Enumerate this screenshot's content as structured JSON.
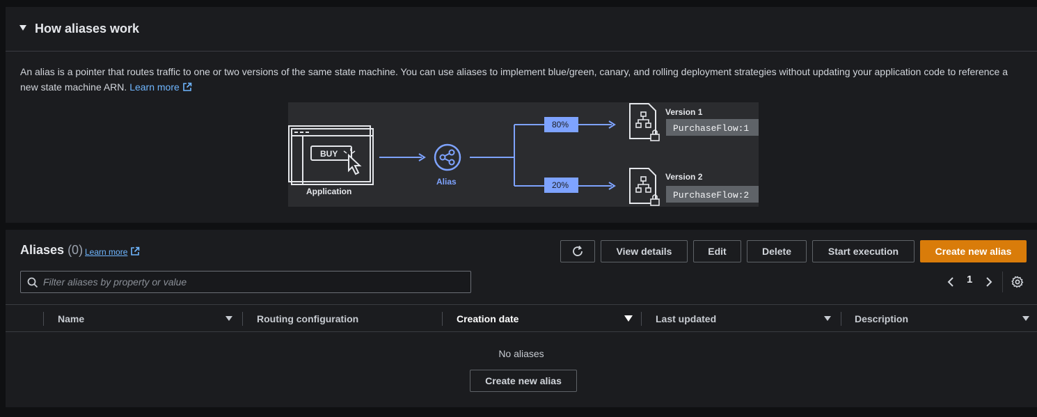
{
  "how_it_works": {
    "title": "How aliases work",
    "description": "An alias is a pointer that routes traffic to one or two versions of the same state machine. You can use aliases to implement blue/green, canary, and rolling deployment strategies without updating your application code to reference a new state machine ARN.",
    "learn_more": "Learn more",
    "diagram": {
      "buy_label": "BUY",
      "application_label": "Application",
      "alias_label": "Alias",
      "split_1": "80%",
      "split_2": "20%",
      "version_1_label": "Version 1",
      "version_1_name": "PurchaseFlow:1",
      "version_2_label": "Version 2",
      "version_2_name": "PurchaseFlow:2",
      "accent_color": "#7ea3ff"
    }
  },
  "aliases": {
    "title": "Aliases",
    "count": "(0)",
    "learn_more": "Learn more",
    "buttons": {
      "refresh_icon": "refresh-icon",
      "view_details": "View details",
      "edit": "Edit",
      "delete": "Delete",
      "start_execution": "Start execution",
      "create_new_alias": "Create new alias"
    },
    "search_placeholder": "Filter aliases by property or value",
    "pagination": {
      "current_page": "1"
    },
    "columns": [
      "Name",
      "Routing configuration",
      "Creation date",
      "Last updated",
      "Description"
    ],
    "empty_text": "No aliases",
    "empty_button": "Create new alias"
  },
  "colors": {
    "primary_button": "#d97c0a",
    "link": "#6fb6ff",
    "panel": "#1b1c1f"
  }
}
